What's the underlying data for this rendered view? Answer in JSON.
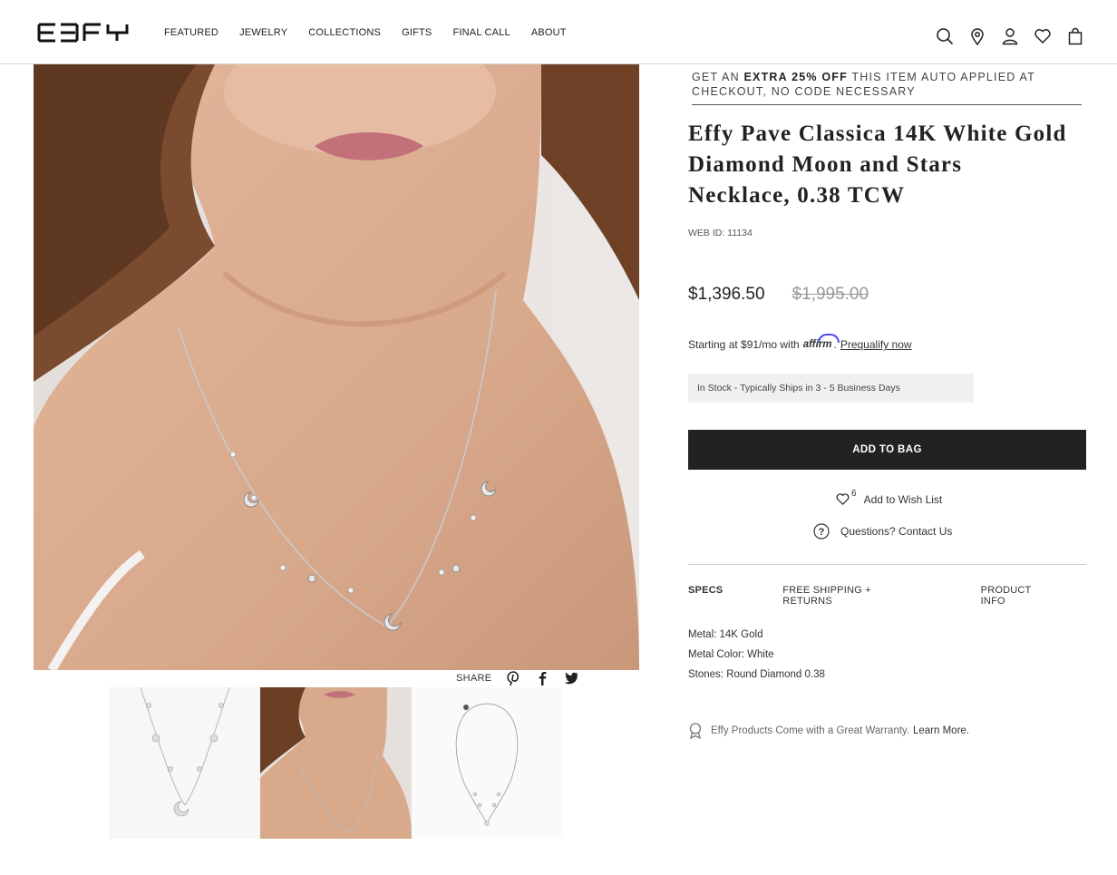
{
  "header": {
    "logo_text": "EFFY",
    "nav": [
      "FEATURED",
      "JEWELRY",
      "COLLECTIONS",
      "GIFTS",
      "FINAL CALL",
      "ABOUT"
    ],
    "icons": [
      "search-icon",
      "location-pin-icon",
      "user-icon",
      "heart-icon",
      "shopping-bag-icon"
    ]
  },
  "product": {
    "promo_prefix": "GET AN ",
    "promo_bold": "EXTRA 25% OFF",
    "promo_suffix": " THIS ITEM AUTO APPLIED AT CHECKOUT, NO CODE NECESSARY",
    "title": "Effy Pave Classica 14K White Gold Diamond Moon and Stars Necklace, 0.38 TCW",
    "web_id": "WEB ID: 11134",
    "price_sale": "$1,396.50",
    "price_original": "$1,995.00",
    "affirm_prefix": "Starting at $91/mo with",
    "affirm_logo": "affirm",
    "affirm_link": "Prequalify now",
    "stock": "In Stock - Typically Ships in 3 - 5 Business Days",
    "add_to_bag": "ADD TO BAG",
    "wishlist_count": "6",
    "wishlist_label": "Add to Wish List",
    "questions_label": "Questions? Contact Us"
  },
  "tabs": [
    "SPECS",
    "FREE SHIPPING + RETURNS",
    "PRODUCT INFO"
  ],
  "specs": [
    "Metal: 14K Gold",
    "Metal Color: White",
    "Stones: Round Diamond 0.38"
  ],
  "warranty": {
    "text": "Effy Products Come with a Great Warranty.",
    "link": "Learn More."
  },
  "share": {
    "label": "SHARE",
    "icons": [
      "pinterest-icon",
      "facebook-icon",
      "twitter-icon"
    ]
  },
  "colors": {
    "button_bg": "#222222",
    "stock_bg": "#f0f0f0",
    "affirm_blue": "#4a4af4"
  }
}
